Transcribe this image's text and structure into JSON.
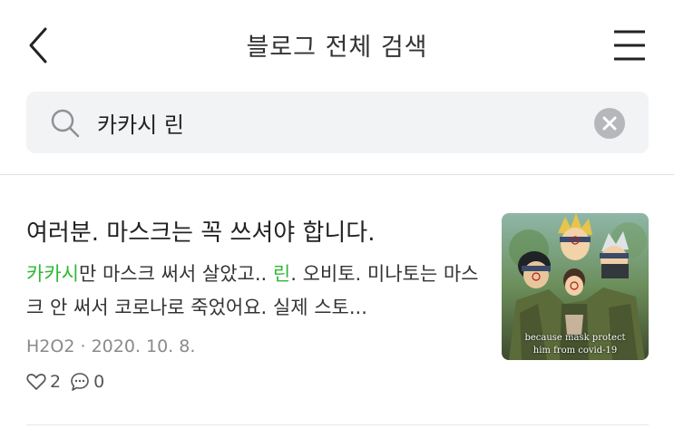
{
  "header": {
    "title": "블로그 전체 검색",
    "back_icon": "chevron-left-icon",
    "menu_icon": "hamburger-menu-icon"
  },
  "search": {
    "query": "카카시 린",
    "search_icon": "search-icon",
    "clear_icon": "clear-circle-icon"
  },
  "result": {
    "title": "여러분. 마스크는 꼭 쓰셔야 합니다.",
    "excerpt_parts": {
      "hl1": "카카시",
      "t1": "만 마스크 써서 살았고.. ",
      "hl2": "린",
      "t2": ". 오비토. 미나토는 마스크 안 써서 코로나로 죽었어요. 실제 스토..."
    },
    "author": "H2O2",
    "separator": "·",
    "date": "2020. 10. 8.",
    "likes": "2",
    "comments": "0",
    "thumbnail_caption_line1": "because mask protect",
    "thumbnail_caption_line2": "him from covid-19",
    "colors": {
      "highlight": "#2fb836"
    }
  }
}
